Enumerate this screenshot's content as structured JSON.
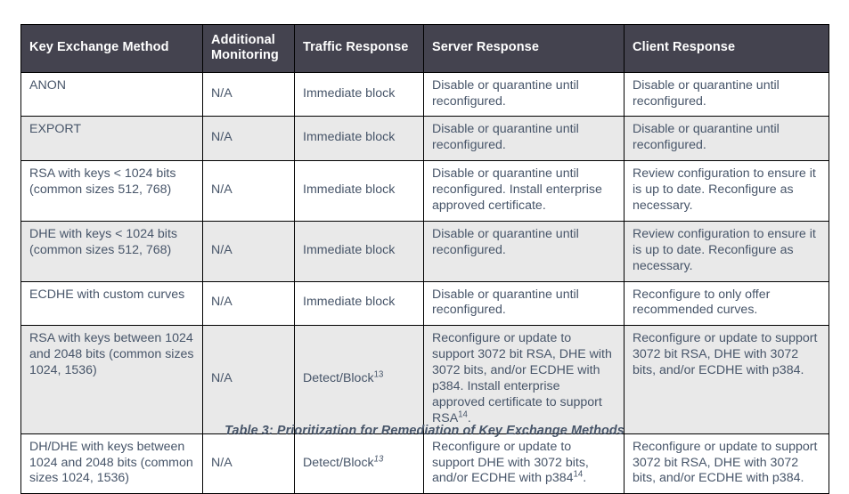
{
  "table": {
    "columns": [
      "Key Exchange Method",
      "Additional Monitoring",
      "Traffic Response",
      "Server Response",
      "Client Response"
    ],
    "rows": [
      {
        "method": "ANON",
        "monitoring": "N/A",
        "traffic": "Immediate block",
        "traffic_sup": "",
        "server": "Disable or quarantine until reconfigured.",
        "server_sup": "",
        "client": "Disable or quarantine until reconfigured."
      },
      {
        "method": "EXPORT",
        "monitoring": "N/A",
        "traffic": "Immediate block",
        "traffic_sup": "",
        "server": "Disable or quarantine until reconfigured.",
        "server_sup": "",
        "client": "Disable or quarantine until reconfigured."
      },
      {
        "method": "RSA with keys < 1024 bits (common sizes 512, 768)",
        "monitoring": "N/A",
        "traffic": "Immediate block",
        "traffic_sup": "",
        "server": "Disable or quarantine until reconfigured. Install enterprise approved certificate.",
        "server_sup": "",
        "client": "Review configuration to ensure it is up to date. Reconfigure as necessary."
      },
      {
        "method": "DHE with keys < 1024 bits (common sizes 512, 768)",
        "monitoring": "N/A",
        "traffic": "Immediate block",
        "traffic_sup": "",
        "server": "Disable or quarantine until reconfigured.",
        "server_sup": "",
        "client": "Review configuration to ensure it is up to date. Reconfigure as necessary."
      },
      {
        "method": "ECDHE with custom curves",
        "monitoring": "N/A",
        "traffic": "Immediate block",
        "traffic_sup": "",
        "server": "Disable or quarantine until reconfigured.",
        "server_sup": "",
        "client": "Reconfigure to only offer recommended curves."
      },
      {
        "method": "RSA with keys between 1024 and 2048 bits (common sizes 1024, 1536)",
        "monitoring": "N/A",
        "traffic": "Detect/Block",
        "traffic_sup": "13",
        "server": "Reconfigure or update to support 3072 bit RSA, DHE with 3072 bits, and/or ECDHE with p384. Install enterprise approved certificate to support RSA",
        "server_sup": "14",
        "server_tail": ".",
        "client": "Reconfigure or update to support 3072 bit RSA, DHE with 3072 bits, and/or ECDHE with p384."
      },
      {
        "method": "DH/DHE with keys between 1024 and 2048 bits (common sizes 1024, 1536)",
        "monitoring": "N/A",
        "traffic": "Detect/Block",
        "traffic_sup": "13",
        "traffic_sup_italic": true,
        "server": "Reconfigure or update to support DHE with 3072 bits, and/or ECDHE with p384",
        "server_sup": "14",
        "server_tail": ".",
        "client": "Reconfigure or update to support 3072 bit RSA, DHE with 3072 bits, and/or ECDHE with p384."
      }
    ]
  },
  "caption": "Table 3: Prioritization for Remediation of Key Exchange Methods",
  "colors": {
    "header_bg": "#44434f",
    "header_text": "#ffffff",
    "body_text": "#475569",
    "stripe_bg": "#e9e9e9",
    "border": "#000000"
  }
}
